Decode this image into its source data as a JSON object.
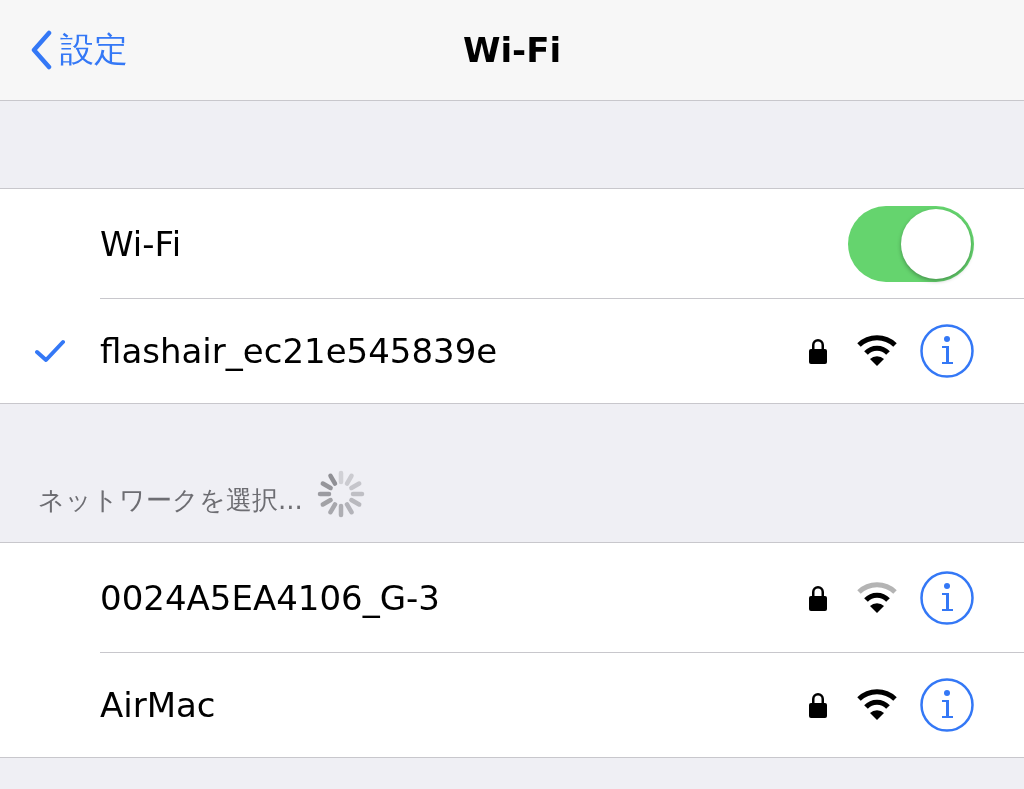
{
  "nav": {
    "back": "設定",
    "title": "Wi-Fi"
  },
  "wifi": {
    "label": "Wi-Fi",
    "on": true
  },
  "current": {
    "name": "flashair_ec21e545839e",
    "connected": true,
    "locked": true,
    "weak": false
  },
  "section": {
    "header": "ネットワークを選択...",
    "searching": true
  },
  "networks": [
    {
      "name": "0024A5EA4106_G-3",
      "locked": true,
      "weak": true
    },
    {
      "name": "AirMac",
      "locked": true,
      "weak": false
    }
  ]
}
